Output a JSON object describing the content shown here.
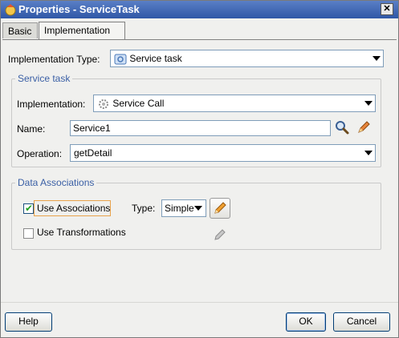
{
  "window": {
    "title": "Properties - ServiceTask",
    "close_glyph": "✕"
  },
  "tabs": [
    {
      "label": "Basic",
      "active": false
    },
    {
      "label": "Implementation",
      "active": true
    }
  ],
  "implementation_type": {
    "label": "Implementation Type:",
    "value": "Service task",
    "icon": "service-task-icon"
  },
  "service_task": {
    "legend": "Service task",
    "implementation": {
      "label": "Implementation:",
      "value": "Service Call",
      "icon": "gear-icon"
    },
    "name": {
      "label": "Name:",
      "value": "Service1"
    },
    "operation": {
      "label": "Operation:",
      "value": "getDetail"
    }
  },
  "data_associations": {
    "legend": "Data Associations",
    "use_associations": {
      "label": "Use Associations",
      "checked": true
    },
    "type": {
      "label": "Type:",
      "value": "Simple"
    },
    "use_transformations": {
      "label": "Use Transformations",
      "checked": false
    }
  },
  "buttons": {
    "help": "Help",
    "ok": "OK",
    "cancel": "Cancel"
  },
  "colors": {
    "title_bar": "#2f57a6",
    "legend_text": "#3a5fa5",
    "background": "#f0f0ee"
  }
}
